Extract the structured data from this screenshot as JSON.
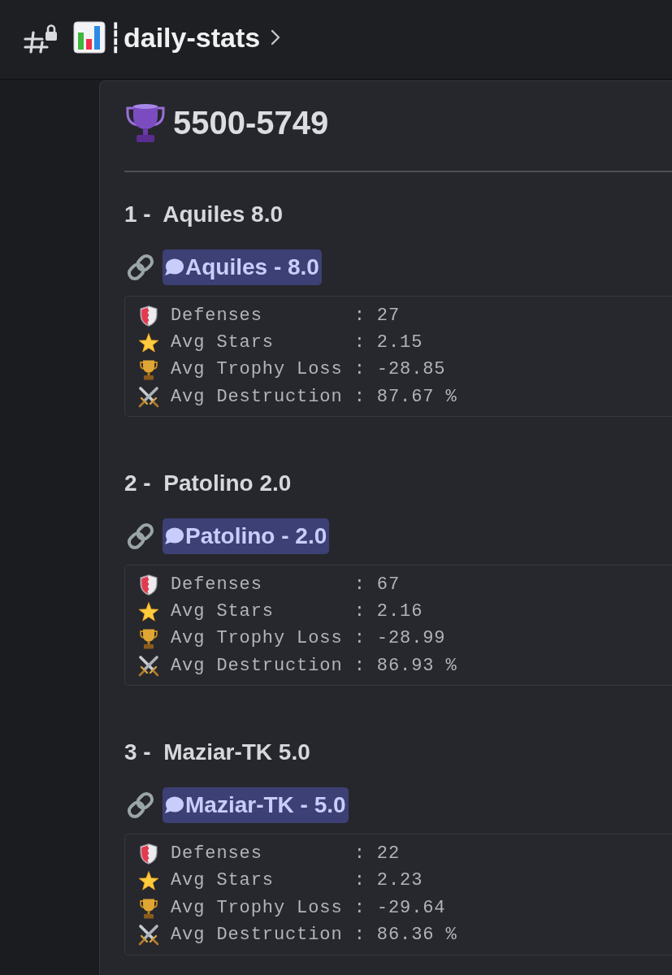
{
  "header": {
    "channel_name": "┊daily-stats"
  },
  "embed": {
    "title": "5500-5749",
    "players": [
      {
        "heading": "1 -  Aquiles 8.0",
        "mention": "Aquiles - 8.0",
        "stats": [
          {
            "kind": "defenses",
            "line": "Defenses        : 27"
          },
          {
            "kind": "stars",
            "line": "Avg Stars       : 2.15"
          },
          {
            "kind": "trophy",
            "line": "Avg Trophy Loss : -28.85"
          },
          {
            "kind": "destruction",
            "line": "Avg Destruction : 87.67 %"
          }
        ]
      },
      {
        "heading": "2 -  Patolino 2.0",
        "mention": "Patolino - 2.0",
        "stats": [
          {
            "kind": "defenses",
            "line": "Defenses        : 67"
          },
          {
            "kind": "stars",
            "line": "Avg Stars       : 2.16"
          },
          {
            "kind": "trophy",
            "line": "Avg Trophy Loss : -28.99"
          },
          {
            "kind": "destruction",
            "line": "Avg Destruction : 86.93 %"
          }
        ]
      },
      {
        "heading": "3 -  Maziar-TK 5.0",
        "mention": "Maziar-TK - 5.0",
        "stats": [
          {
            "kind": "defenses",
            "line": "Defenses        : 22"
          },
          {
            "kind": "stars",
            "line": "Avg Stars       : 2.23"
          },
          {
            "kind": "trophy",
            "line": "Avg Trophy Loss : -29.64"
          },
          {
            "kind": "destruction",
            "line": "Avg Destruction : 86.36 %"
          }
        ]
      }
    ]
  }
}
